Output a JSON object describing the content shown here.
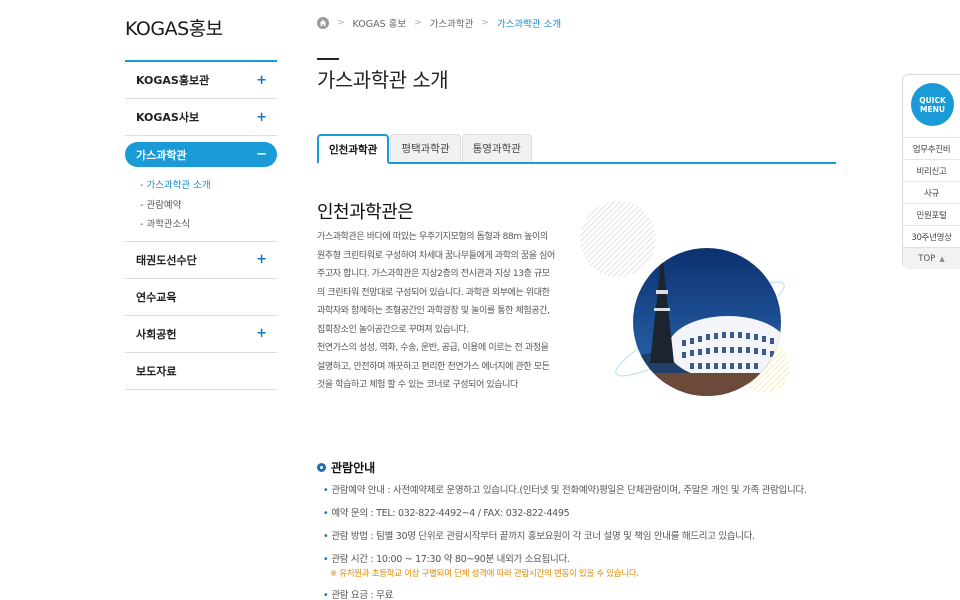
{
  "sidebar": {
    "title": "KOGAS홍보",
    "items": [
      {
        "label": "KOGAS홍보관",
        "has_plus": true
      },
      {
        "label": "KOGAS사보",
        "has_plus": true
      },
      {
        "label": "가스과학관",
        "active": true
      },
      {
        "label": "태권도선수단",
        "has_plus": true
      },
      {
        "label": "연수교육",
        "has_plus": false
      },
      {
        "label": "사회공헌",
        "has_plus": true
      },
      {
        "label": "보도자료",
        "has_plus": false
      }
    ],
    "sub_items": [
      {
        "label": "- 가스과학관 소개",
        "current": true
      },
      {
        "label": "- 관람예약"
      },
      {
        "label": "- 과학관소식"
      }
    ],
    "plus_symbol": "+",
    "minus_symbol": "−"
  },
  "breadcrumb": {
    "items": [
      "KOGAS 홍보",
      "가스과학관",
      "가스과학관 소개"
    ],
    "separator": ">"
  },
  "page": {
    "title": "가스과학관 소개"
  },
  "tabs": [
    {
      "label": "인천과학관",
      "active": true
    },
    {
      "label": "평택과학관"
    },
    {
      "label": "통영과학관"
    }
  ],
  "intro": {
    "heading": "인천과학관은",
    "paragraph1": "가스과학관은 바다에 떠있는 우주기지모형의 돔형과 88m 높이의 원추형 크린타워로 구성하여 차세대 꿈나무들에게 과학의 꿈을 심어주고자 합니다. 가스과학관은 지상2층의 전시관과 지상 13층 규모의 크린타워 전망대로 구성되어 있습니다. 과학관 외부에는 위대한 과학자와 함께하는 조형공간인 과학광장 및 놀이를 통한 체험공간, 집회장소인 놀이공간으로 꾸며져 있습니다.",
    "paragraph2": "천연가스의 성성, 역화, 수송, 운반, 공급, 이용에 이르는 전 과정을 설명하고, 안전하며 깨끗하고 편리한 천연가스 에너지에 관한 모든 것을 학습하고 체험 할 수 있는 코너로 구성되어 있습니다"
  },
  "viewing_info": {
    "heading": "관람안내",
    "items": [
      {
        "text": "관람예약 안내 : 사전예약제로 운영하고 있습니다.(인터넷 및 전화예약)평일은 단체관람이며, 주말은 개인 및 가족 관람입니다."
      },
      {
        "text": "예약 문의 : TEL: 032-822-4492~4 / FAX: 032-822-4495"
      },
      {
        "text": "관람 방법 : 팀별 30명 단위로 관람시작부터 끝까지 홍보요원이 각 코너 설명 및 책임 안내를 해드리고 있습니다."
      },
      {
        "text": "관람 시간 : 10:00 ~ 17:30 약 80~90분 내외가 소요됩니다.",
        "note": "※ 유치원과 초등학교 이상 구별되며 단체 성격에 따라 관람시간의 변동이 있을 수 있습니다."
      },
      {
        "text": "관람 요금 : 무료"
      }
    ],
    "bullet": "•"
  },
  "quick_menu": {
    "button_line1": "QUICK",
    "button_line2": "MENU",
    "items": [
      "업무추진비",
      "비리신고",
      "사규",
      "민원포털",
      "30주년영상"
    ],
    "top_label": "TOP",
    "top_caret": "▲"
  },
  "colors": {
    "accent": "#1a9ad6",
    "note": "#e58a00"
  }
}
